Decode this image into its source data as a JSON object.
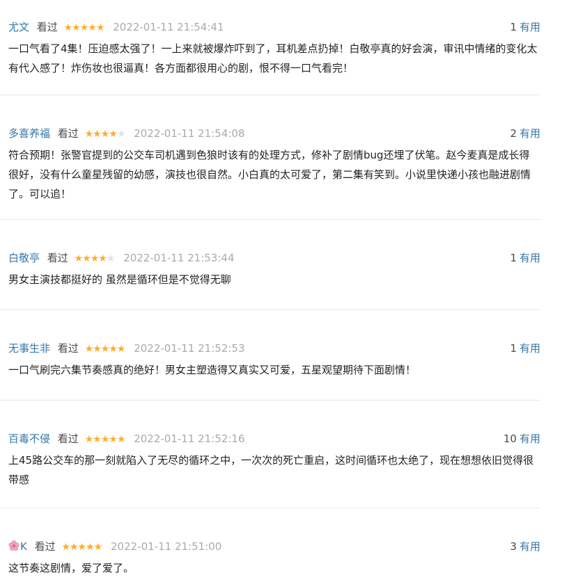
{
  "reviews": [
    {
      "user": "尤文",
      "watched": "看过",
      "rating": 5,
      "time": "2022-01-11 21:54:41",
      "useful_count": "1",
      "useful_label": "有用",
      "content": "一口气看了4集！压迫感太强了！一上来就被爆炸吓到了，耳机差点扔掉！白敬亭真的好会演，审讯中情绪的变化太有代入感了！炸伤妆也很逼真！各方面都很用心的剧，恨不得一口气看完！"
    },
    {
      "user": "多喜养福",
      "watched": "看过",
      "rating": 4,
      "time": "2022-01-11 21:54:08",
      "useful_count": "2",
      "useful_label": "有用",
      "content": "符合预期！张警官提到的公交车司机遇到色狼时该有的处理方式，修补了剧情bug还埋了伏笔。赵今麦真是成长得很好，没有什么童星残留的幼感，演技也很自然。小白真的太可爱了，第二集有笑到。小说里快递小孩也融进剧情了。可以追！"
    },
    {
      "user": "白敬亭",
      "watched": "看过",
      "rating": 4,
      "time": "2022-01-11 21:53:44",
      "useful_count": "1",
      "useful_label": "有用",
      "content": "男女主演技都挺好的 虽然是循环但是不觉得无聊"
    },
    {
      "user": "无事生非",
      "watched": "看过",
      "rating": 5,
      "time": "2022-01-11 21:52:53",
      "useful_count": "1",
      "useful_label": "有用",
      "content": "一口气刷完六集节奏感真的绝好！男女主塑造得又真实又可爱，五星观望期待下面剧情！"
    },
    {
      "user": "百毒不侵",
      "watched": "看过",
      "rating": 5,
      "time": "2022-01-11 21:52:16",
      "useful_count": "10",
      "useful_label": "有用",
      "content": "上45路公交车的那一刻就陷入了无尽的循环之中，一次次的死亡重启，这时间循环也太绝了，现在想想依旧觉得很带感"
    },
    {
      "user": "K",
      "user_icon": "cherry-blossom-icon",
      "watched": "看过",
      "rating": 5,
      "time": "2022-01-11 21:51:00",
      "useful_count": "3",
      "useful_label": "有用",
      "content": "这节奏这剧情，爱了爱了。"
    }
  ],
  "colors": {
    "link": "#3377aa",
    "star": "#ffac2d",
    "star_empty": "#e0e0e0",
    "time": "#aaaaaa",
    "divider": "#e8e8e8"
  }
}
